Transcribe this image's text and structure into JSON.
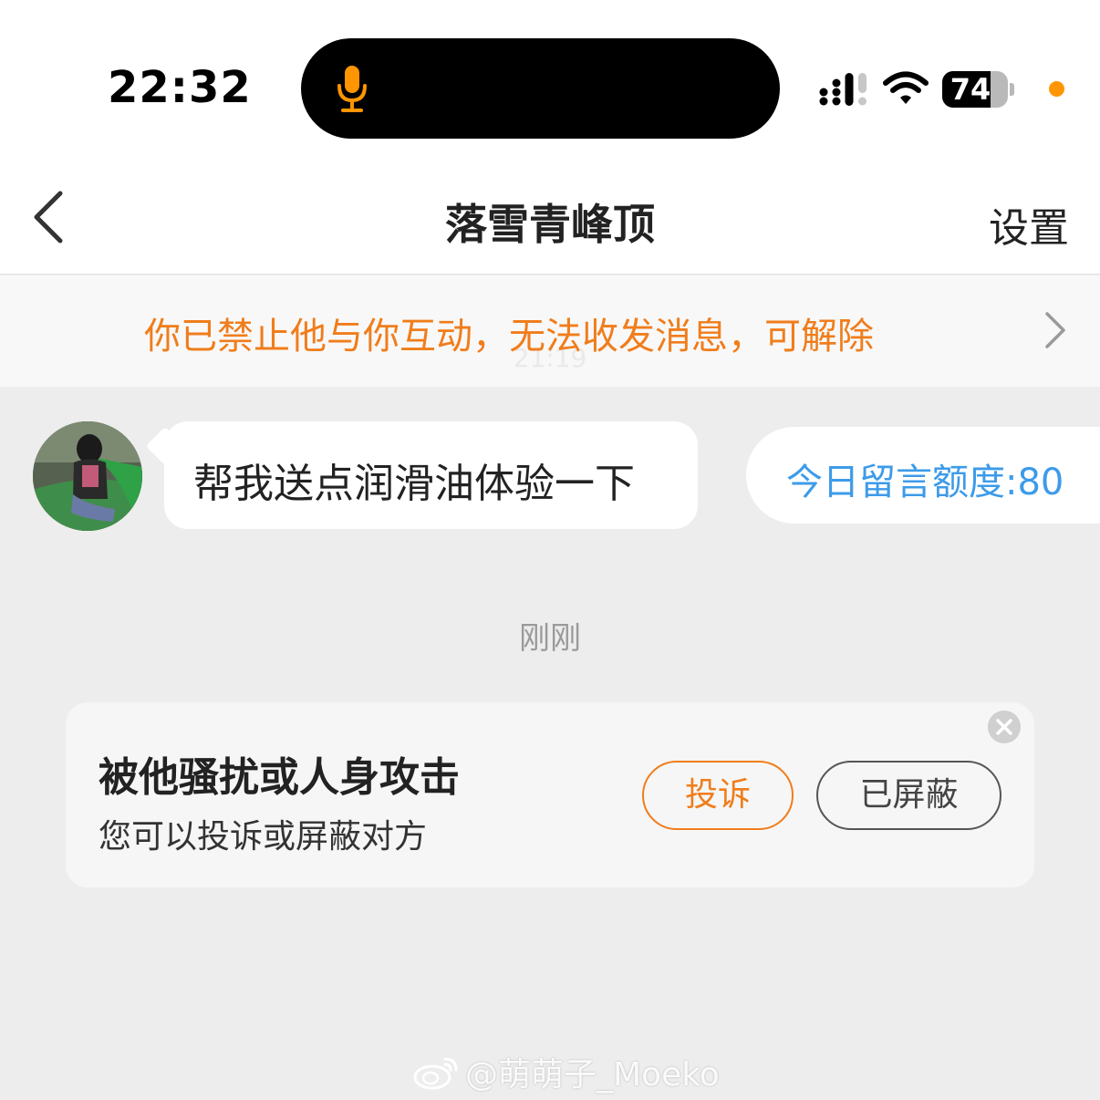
{
  "status_bar": {
    "time": "22:32",
    "battery_percent": "74",
    "battery_level": 0.74,
    "mic_color": "#ff9500",
    "dot_color": "#ff9500",
    "icons": [
      "mic-icon",
      "signal-icon",
      "wifi-icon",
      "battery-icon"
    ]
  },
  "nav": {
    "title": "落雪青峰顶",
    "settings_label": "设置",
    "back_icon": "chevron-left-icon"
  },
  "banner": {
    "text": "你已禁止他与你互动，无法收发消息，可解除",
    "ghost_time": "21:19",
    "color": "#f07d1b"
  },
  "messages": [
    {
      "sender": "other",
      "text": "帮我送点润滑油体验一下"
    }
  ],
  "quota": {
    "text": "今日留言额度:80",
    "color": "#3d9be9"
  },
  "timestamp": "刚刚",
  "report_card": {
    "title": "被他骚扰或人身攻击",
    "subtitle": "您可以投诉或屏蔽对方",
    "report_label": "投诉",
    "blocked_label": "已屏蔽"
  },
  "watermark": {
    "text": "@萌萌子_Moeko"
  }
}
